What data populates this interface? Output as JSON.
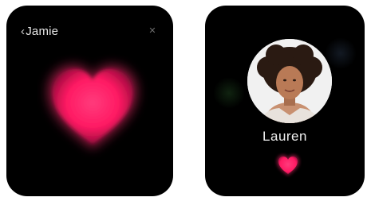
{
  "screens": [
    {
      "title": "Jamie",
      "back_icon": "chevron-left-icon",
      "close_icon": "close-icon",
      "heart_color": "#ff2d6f"
    },
    {
      "contact_name": "Lauren",
      "avatar": "contact-photo",
      "heart_color": "#ff2d6f"
    }
  ],
  "colors": {
    "watch_background": "#000000",
    "heart_pink": "#ff2d6f",
    "text": "#f0f0f0"
  }
}
